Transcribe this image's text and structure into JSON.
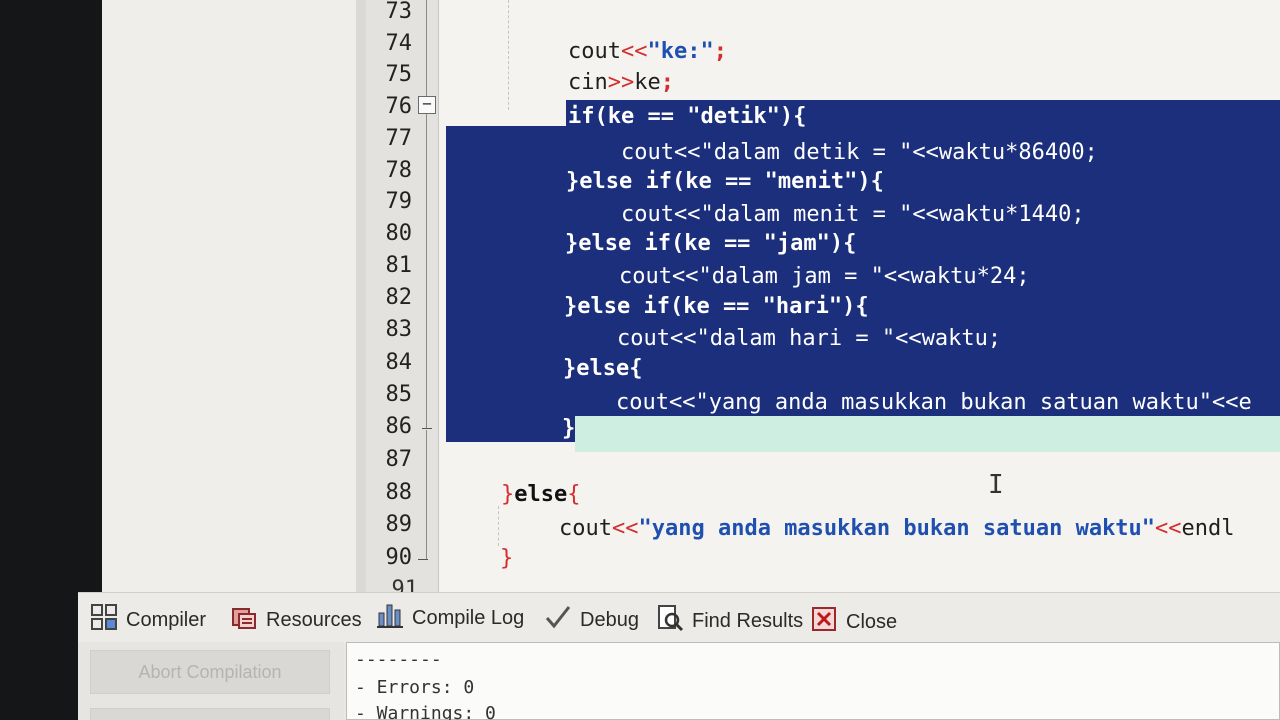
{
  "editor": {
    "line_numbers": [
      "73",
      "74",
      "75",
      "76",
      "77",
      "78",
      "79",
      "80",
      "81",
      "82",
      "83",
      "84",
      "85",
      "86",
      "87",
      "88",
      "89",
      "90"
    ],
    "partial_line_number": "91",
    "fold_symbol": "−",
    "lines": {
      "l74": [
        "cout",
        "<<",
        "\"ke:\"",
        ";"
      ],
      "l75": [
        "cin",
        ">>",
        "ke",
        ";"
      ],
      "l76": "if(ke == \"detik\"){",
      "l77": "    cout<<\"dalam detik = \"<<waktu*86400;",
      "l78": "}else if(ke == \"menit\"){",
      "l79": "    cout<<\"dalam menit = \"<<waktu*1440;",
      "l80": "}else if(ke == \"jam\"){",
      "l81": "    cout<<\"dalam jam = \"<<waktu*24;",
      "l82": "}else if(ke == \"hari\"){",
      "l83": "    cout<<\"dalam hari = \"<<waktu;",
      "l84": "}else{",
      "l85": "    cout<<\"yang anda masukkan bukan satuan waktu\"<<e",
      "l86": "}",
      "l88": [
        "}",
        "else",
        "{"
      ],
      "l89": [
        "cout",
        "<<",
        "\"yang anda masukkan bukan satuan waktu\"",
        "<<",
        "endl"
      ],
      "l90": "}"
    },
    "selection_color": "#1c2f7d",
    "current_line_color": "#cfeee2"
  },
  "tabs": [
    {
      "label": "Compiler",
      "icon": "compiler-grid-icon"
    },
    {
      "label": "Resources",
      "icon": "resources-icon"
    },
    {
      "label": "Compile Log",
      "icon": "bar-chart-icon"
    },
    {
      "label": "Debug",
      "icon": "check-icon"
    },
    {
      "label": "Find Results",
      "icon": "find-icon"
    },
    {
      "label": "Close",
      "icon": "close-icon"
    }
  ],
  "bottom_panel": {
    "abort_label": "Abort Compilation",
    "log_lines": [
      "--------",
      "- Errors: 0",
      "- Warnings: 0"
    ]
  }
}
